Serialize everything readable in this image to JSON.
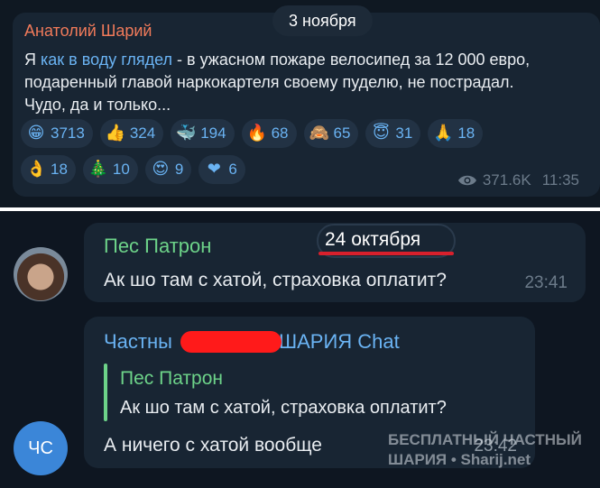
{
  "post": {
    "author": "Анатолий Шарий",
    "date_pill": "3 ноября",
    "text_prefix": "Я ",
    "text_link": "как в воду глядел",
    "text_rest": " - в ужасном пожаре велосипед за 12 000 евро, подаренный главой наркокартеля своему пуделю, не пострадал. Чудо, да и только...",
    "reactions_row1": [
      {
        "emoji": "😁",
        "count": "3713",
        "icon": "grin-emoji"
      },
      {
        "emoji": "👍",
        "count": "324",
        "icon": "thumbs-up-emoji"
      },
      {
        "emoji": "🐳",
        "count": "194",
        "icon": "whale-emoji"
      },
      {
        "emoji": "🔥",
        "count": "68",
        "icon": "fire-emoji"
      },
      {
        "emoji": "🙈",
        "count": "65",
        "icon": "see-no-evil-emoji"
      },
      {
        "emoji": "😇",
        "count": "31",
        "icon": "halo-emoji"
      },
      {
        "emoji": "🙏",
        "count": "18",
        "icon": "pray-emoji"
      }
    ],
    "reactions_row2": [
      {
        "emoji": "👌",
        "count": "18",
        "icon": "ok-hand-emoji"
      },
      {
        "emoji": "🎄",
        "count": "10",
        "icon": "tree-emoji"
      },
      {
        "emoji": "😍",
        "count": "9",
        "icon": "heart-eyes-emoji"
      },
      {
        "emoji": "❤",
        "count": "6",
        "icon": "heart-emoji"
      }
    ],
    "views": "371.6K",
    "time": "11:35"
  },
  "chat": {
    "date_tag": "24 октября",
    "msg1": {
      "sender": "Пес Патрон",
      "text": "Ак шо там с хатой, страховка оплатит?",
      "time": "23:41"
    },
    "msg2": {
      "sender_start": "Частны",
      "sender_end": "ШАРИЯ Chat",
      "reply_name": "Пес Патрон",
      "reply_text": "Ак шо там с хатой, страховка оплатит?",
      "text": "А ничего с хатой вообще",
      "time": "23:42"
    },
    "avatar_initials": "ЧС"
  },
  "watermark": {
    "line1": "БЕСПЛАТНЫЙ ЧАСТНЫЙ",
    "line2": "ШАРИЯ • Sharij.net"
  },
  "colors": {
    "background": "#0e1621",
    "bubble": "#182533",
    "author_orange": "#f07a5a",
    "link_blue": "#6ab3f3",
    "sender_green": "#6dd389",
    "redaction_red": "#ff1a1a"
  }
}
